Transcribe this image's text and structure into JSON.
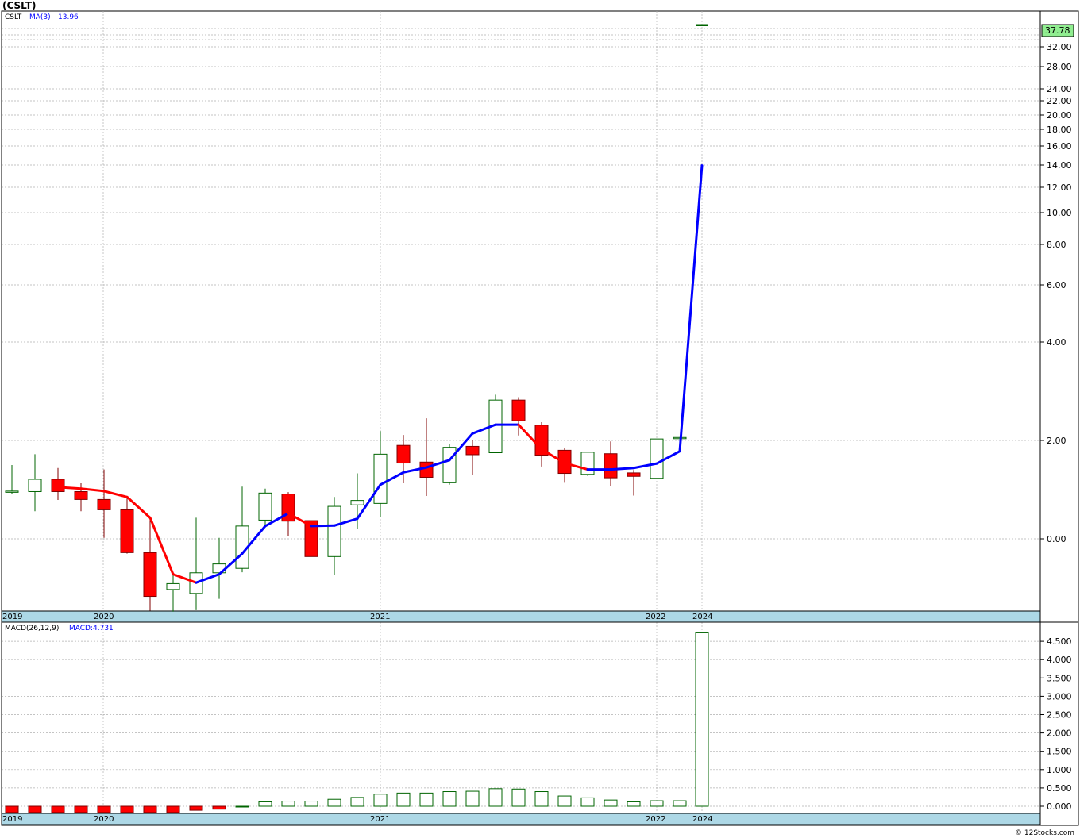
{
  "title": "(CSLT)",
  "legend_top": {
    "symbol": "CSLT",
    "ma_label": "MA(3)",
    "ma_value": "13.96"
  },
  "legend_bottom": {
    "macd_params": "MACD(26,12,9)",
    "macd_value": "MACD:4.731"
  },
  "last_price_badge": "37.78",
  "credit": "© 12Stocks.com",
  "colors": {
    "up": "#006400",
    "down": "#ff0000",
    "ma_up": "#0000ff",
    "ma_down": "#ff0000",
    "badge": "#90ee90",
    "axis_band": "#add8e6",
    "grid": "#b0b0b0"
  },
  "chart_data": [
    {
      "type": "candlestick",
      "title": "(CSLT)",
      "yscale": "log",
      "ytick_labels": [
        "32.00",
        "28.00",
        "24.00",
        "22.00",
        "20.00",
        "18.00",
        "16.00",
        "14.00",
        "12.00",
        "10.00",
        "8.00",
        "6.00",
        "4.00",
        "2.00",
        "0.00"
      ],
      "ytick_values": [
        32,
        28,
        24,
        22,
        20,
        18,
        16,
        14,
        12,
        10,
        8,
        6,
        4,
        2,
        0
      ],
      "year_labels": [
        "2019",
        "2020",
        "2021",
        "2022",
        "2024"
      ],
      "candles": [
        {
          "o": 0.95,
          "h": 1.5,
          "l": 0.92,
          "c": 0.97
        },
        {
          "o": 0.96,
          "h": 1.72,
          "l": 0.56,
          "c": 1.21
        },
        {
          "o": 1.21,
          "h": 1.44,
          "l": 0.79,
          "c": 0.96
        },
        {
          "o": 0.96,
          "h": 1.13,
          "l": 0.56,
          "c": 0.8
        },
        {
          "o": 0.8,
          "h": 1.41,
          "l": 0.02,
          "c": 0.59
        },
        {
          "o": 0.59,
          "h": 0.86,
          "l": -0.3,
          "c": -0.28
        },
        {
          "o": -0.28,
          "h": 0.44,
          "l": -1.46,
          "c": -1.17
        },
        {
          "o": -1.03,
          "h": -0.74,
          "l": -1.48,
          "c": -0.91
        },
        {
          "o": -1.11,
          "h": 0.43,
          "l": -1.45,
          "c": -0.69
        },
        {
          "o": -0.69,
          "h": 0.02,
          "l": -1.22,
          "c": -0.51
        },
        {
          "o": -0.6,
          "h": 1.06,
          "l": -0.68,
          "c": 0.26
        },
        {
          "o": 0.38,
          "h": 1.02,
          "l": 0.27,
          "c": 0.93
        },
        {
          "o": 0.91,
          "h": 0.95,
          "l": 0.05,
          "c": 0.36
        },
        {
          "o": 0.37,
          "h": 0.37,
          "l": -0.35,
          "c": -0.36
        },
        {
          "o": -0.36,
          "h": 0.85,
          "l": -0.74,
          "c": 0.66
        },
        {
          "o": 0.69,
          "h": 1.33,
          "l": 0.21,
          "c": 0.78
        },
        {
          "o": 0.72,
          "h": 2.19,
          "l": 0.45,
          "c": 1.72
        },
        {
          "o": 1.9,
          "h": 2.11,
          "l": 1.13,
          "c": 1.54
        },
        {
          "o": 1.56,
          "h": 2.45,
          "l": 0.87,
          "c": 1.25
        },
        {
          "o": 1.14,
          "h": 1.93,
          "l": 1.1,
          "c": 1.86
        },
        {
          "o": 1.88,
          "h": 2.0,
          "l": 1.3,
          "c": 1.71
        },
        {
          "o": 1.75,
          "h": 2.93,
          "l": 1.75,
          "c": 2.82
        },
        {
          "o": 2.82,
          "h": 2.88,
          "l": 2.1,
          "c": 2.4
        },
        {
          "o": 2.31,
          "h": 2.37,
          "l": 1.47,
          "c": 1.7
        },
        {
          "o": 1.8,
          "h": 1.84,
          "l": 1.14,
          "c": 1.33
        },
        {
          "o": 1.31,
          "h": 1.77,
          "l": 1.28,
          "c": 1.76
        },
        {
          "o": 1.73,
          "h": 1.98,
          "l": 1.08,
          "c": 1.24
        },
        {
          "o": 1.34,
          "h": 1.4,
          "l": 0.88,
          "c": 1.27
        },
        {
          "o": 1.23,
          "h": 2.03,
          "l": 1.23,
          "c": 2.03
        },
        {
          "o": 2.06,
          "h": 2.06,
          "l": 2.06,
          "c": 2.06
        },
        {
          "o": 37.78,
          "h": 37.78,
          "l": 37.78,
          "c": 37.78
        }
      ],
      "ma": [
        null,
        null,
        1.05,
        1.02,
        0.97,
        0.85,
        0.43,
        -0.72,
        -0.89,
        -0.72,
        -0.3,
        0.26,
        0.52,
        0.26,
        0.27,
        0.41,
        1.1,
        1.35,
        1.45,
        1.6,
        2.14,
        2.32,
        2.32,
        1.82,
        1.54,
        1.41,
        1.41,
        1.44,
        1.53,
        1.78,
        13.96
      ]
    },
    {
      "type": "bar",
      "title": "MACD(26,12,9)",
      "ytick_labels": [
        "4.500",
        "4.000",
        "3.500",
        "3.000",
        "2.500",
        "2.000",
        "1.500",
        "1.000",
        "0.500",
        "0.000"
      ],
      "ytick_values": [
        4.5,
        4.0,
        3.5,
        3.0,
        2.5,
        2.0,
        1.5,
        1.0,
        0.5,
        0.0
      ],
      "year_labels": [
        "2019",
        "2020",
        "2021",
        "2022",
        "2024"
      ],
      "values": [
        -0.17,
        -0.17,
        -0.17,
        -0.17,
        -0.17,
        -0.17,
        -0.17,
        -0.17,
        -0.11,
        -0.08,
        0.0,
        0.12,
        0.14,
        0.14,
        0.19,
        0.24,
        0.33,
        0.36,
        0.36,
        0.4,
        0.41,
        0.48,
        0.47,
        0.4,
        0.28,
        0.23,
        0.17,
        0.12,
        0.15,
        0.15,
        4.731
      ]
    }
  ]
}
